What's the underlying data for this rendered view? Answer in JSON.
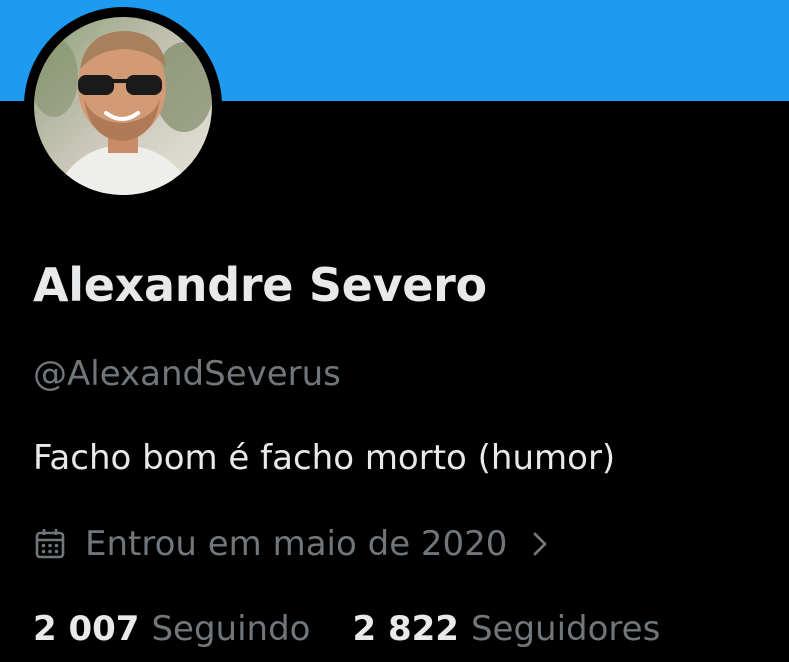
{
  "colors": {
    "banner": "#1d9bf0",
    "background": "#000000",
    "primary_text": "#e7e9ea",
    "secondary_text": "#71767b"
  },
  "profile": {
    "display_name": "Alexandre Severo",
    "handle": "@AlexandSeverus",
    "bio": "Facho bom é facho morto (humor)",
    "joined": "Entrou em maio de 2020",
    "joined_icon": "calendar-icon",
    "joined_chevron_icon": "chevron-right-icon",
    "avatar_alt": "profile photo: man with sunglasses smiling"
  },
  "stats": {
    "following_count": "2 007",
    "following_label": "Seguindo",
    "followers_count": "2 822",
    "followers_label": "Seguidores"
  }
}
